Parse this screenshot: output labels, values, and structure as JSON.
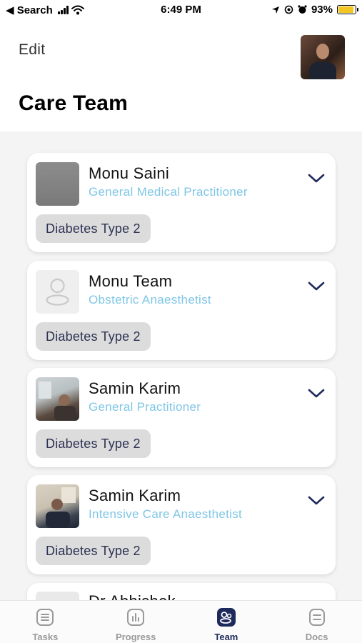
{
  "status_bar": {
    "back_label": "◀ Search",
    "time": "6:49 PM",
    "battery": "93%",
    "battery_level": 0.93
  },
  "header": {
    "edit_label": "Edit",
    "title": "Care Team"
  },
  "team": [
    {
      "name": "Monu Saini",
      "role": "General Medical Practitioner",
      "condition": "Diabetes Type 2",
      "avatar": "gray-photo"
    },
    {
      "name": "Monu Team",
      "role": "Obstetric Anaesthetist",
      "condition": "Diabetes Type 2",
      "avatar": "person-placeholder-icon"
    },
    {
      "name": "Samin Karim",
      "role": "General Practitioner",
      "condition": "Diabetes Type 2",
      "avatar": "photo"
    },
    {
      "name": "Samin Karim",
      "role": "Intensive Care Anaesthetist",
      "condition": "Diabetes Type 2",
      "avatar": "photo"
    }
  ],
  "partial_item": {
    "name": "Dr Abhishek"
  },
  "tabs": [
    {
      "label": "Tasks",
      "icon": "list-icon",
      "active": false
    },
    {
      "label": "Progress",
      "icon": "bar-chart-icon",
      "active": false
    },
    {
      "label": "Team",
      "icon": "team-icon",
      "active": true
    },
    {
      "label": "Docs",
      "icon": "document-icon",
      "active": false
    }
  ],
  "colors": {
    "role_text": "#7fc6e6",
    "tag_background": "#dcdcdc",
    "tag_text": "#2b3152",
    "active_tab": "#1f2a5c",
    "inactive_tab": "#9a9a9a",
    "battery_fill": "#f3c623"
  }
}
